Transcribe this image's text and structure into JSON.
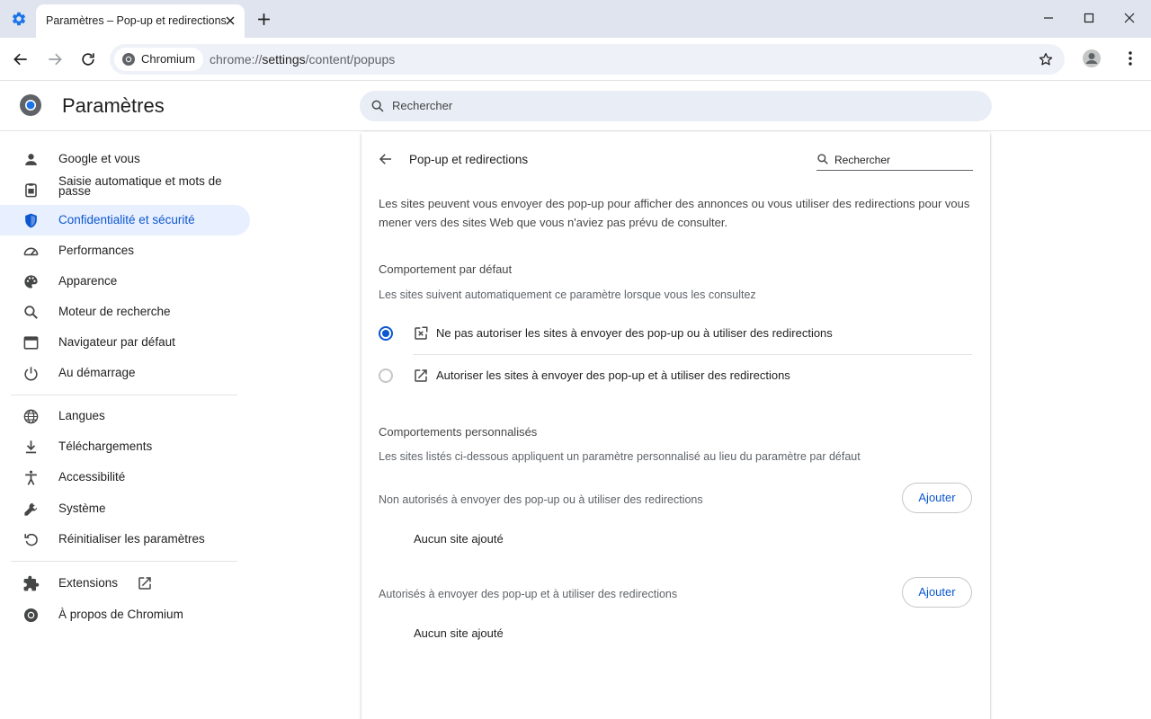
{
  "browser": {
    "tab": {
      "title": "Paramètres – Pop-up et redirections"
    },
    "omnibox": {
      "chip_label": "Chromium",
      "url_scheme": "chrome://",
      "url_host": "settings",
      "url_path": "/content/popups"
    }
  },
  "header": {
    "title": "Paramètres",
    "search_placeholder": "Rechercher"
  },
  "sidebar": {
    "items": [
      {
        "label": "Google et vous",
        "icon": "person-icon"
      },
      {
        "label": "Saisie automatique et mots de passe",
        "icon": "clipboard-icon"
      },
      {
        "label": "Confidentialité et sécurité",
        "icon": "shield-icon",
        "active": true
      },
      {
        "label": "Performances",
        "icon": "speedometer-icon"
      },
      {
        "label": "Apparence",
        "icon": "palette-icon"
      },
      {
        "label": "Moteur de recherche",
        "icon": "search-icon"
      },
      {
        "label": "Navigateur par défaut",
        "icon": "browser-window-icon"
      },
      {
        "label": "Au démarrage",
        "icon": "power-icon"
      },
      {
        "label": "Langues",
        "icon": "globe-icon"
      },
      {
        "label": "Téléchargements",
        "icon": "download-icon"
      },
      {
        "label": "Accessibilité",
        "icon": "accessibility-icon"
      },
      {
        "label": "Système",
        "icon": "wrench-icon"
      },
      {
        "label": "Réinitialiser les paramètres",
        "icon": "reset-icon"
      },
      {
        "label": "Extensions",
        "icon": "puzzle-icon"
      },
      {
        "label": "À propos de Chromium",
        "icon": "chromium-logo-icon"
      }
    ]
  },
  "main": {
    "title": "Pop-up et redirections",
    "search_placeholder": "Rechercher",
    "description": "Les sites peuvent vous envoyer des pop-up pour afficher des annonces ou vous utiliser des redirections pour vous mener vers des sites Web que vous n'aviez pas prévu de consulter.",
    "default_behavior": {
      "heading": "Comportement par défaut",
      "subtext": "Les sites suivent automatiquement ce paramètre lorsque vous les consultez",
      "options": [
        {
          "label": "Ne pas autoriser les sites à envoyer des pop-up ou à utiliser des redirections",
          "selected": true,
          "icon": "popup-blocked-icon"
        },
        {
          "label": "Autoriser les sites à envoyer des pop-up et à utiliser des redirections",
          "selected": false,
          "icon": "open-in-new-icon"
        }
      ]
    },
    "custom_behaviors": {
      "heading": "Comportements personnalisés",
      "subtext": "Les sites listés ci-dessous appliquent un paramètre personnalisé au lieu du paramètre par défaut",
      "lists": [
        {
          "label": "Non autorisés à envoyer des pop-up ou à utiliser des redirections",
          "add_label": "Ajouter",
          "empty_text": "Aucun site ajouté"
        },
        {
          "label": "Autorisés à envoyer des pop-up et à utiliser des redirections",
          "add_label": "Ajouter",
          "empty_text": "Aucun site ajouté"
        }
      ]
    }
  },
  "colors": {
    "accent": "#0b57d0",
    "active_nav_bg": "#e8efff",
    "tabstrip_bg": "#dfe4ef"
  }
}
